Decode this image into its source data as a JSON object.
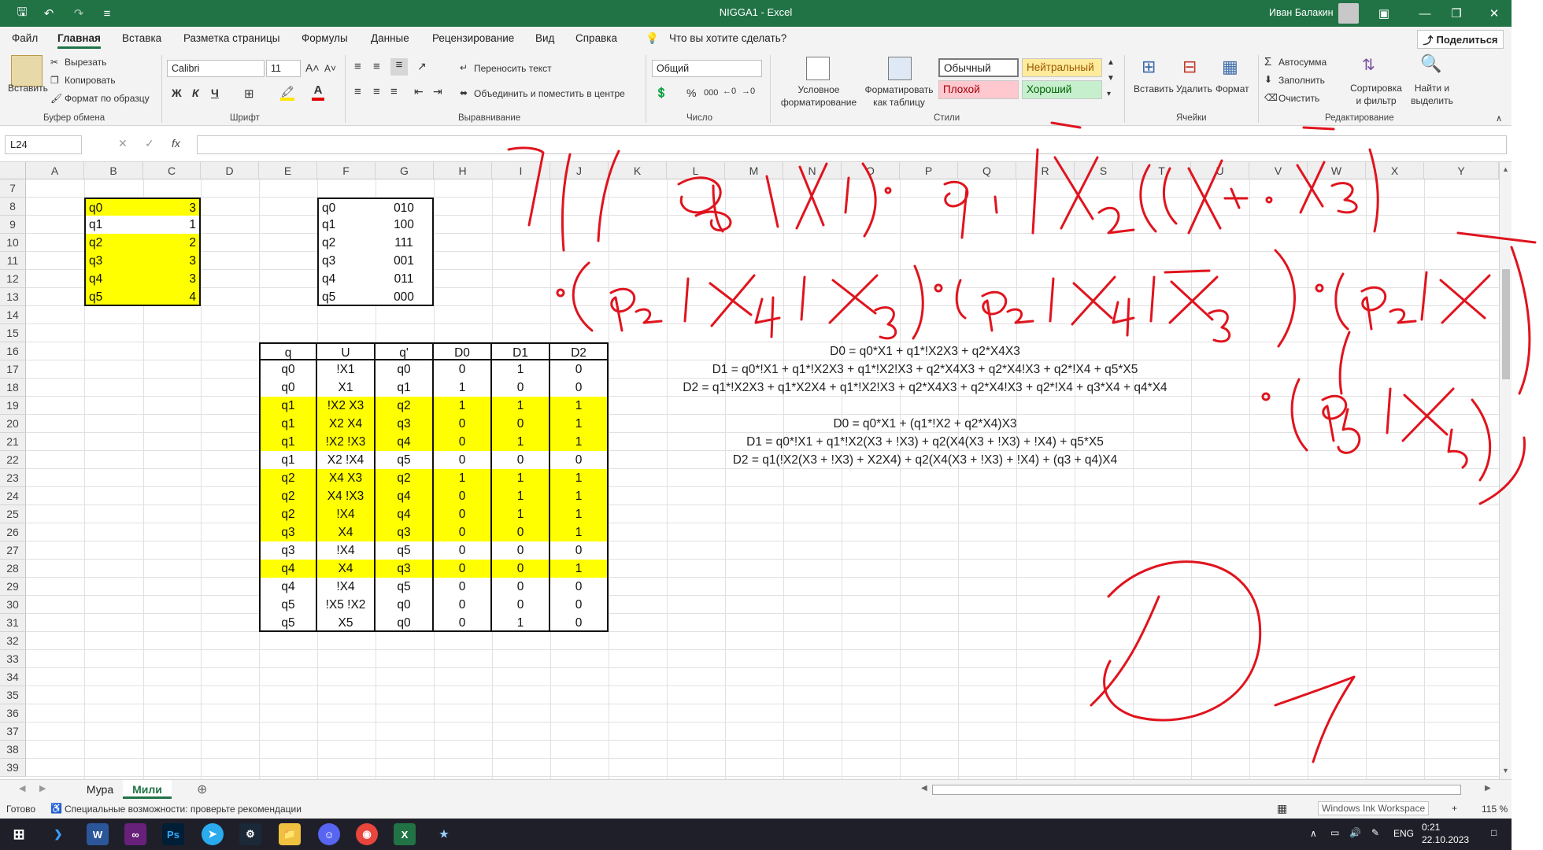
{
  "window": {
    "title": "NIGGA1 - Excel",
    "user": "Иван Балакин"
  },
  "menu": {
    "tabs": [
      "Файл",
      "Главная",
      "Вставка",
      "Разметка страницы",
      "Формулы",
      "Данные",
      "Рецензирование",
      "Вид",
      "Справка"
    ],
    "search": "Что вы хотите сделать?",
    "share": "Поделиться"
  },
  "ribbon": {
    "clipboard": {
      "paste": "Вставить",
      "cut": "Вырезать",
      "copy": "Копировать",
      "format_painter": "Формат по образцу",
      "label": "Буфер обмена"
    },
    "font": {
      "name": "Calibri",
      "size": "11",
      "bold": "Ж",
      "italic": "К",
      "underline": "Ч",
      "label": "Шрифт"
    },
    "alignment": {
      "wrap": "Переносить текст",
      "merge": "Объединить и поместить в центре",
      "label": "Выравнивание"
    },
    "number": {
      "format": "Общий",
      "label": "Число"
    },
    "styles": {
      "conditional": "Условное форматирование",
      "table": "Форматировать как таблицу",
      "normal": "Обычный",
      "neutral": "Нейтральный",
      "bad": "Плохой",
      "good": "Хороший",
      "label": "Стили"
    },
    "cells": {
      "insert": "Вставить",
      "delete": "Удалить",
      "format": "Формат",
      "label": "Ячейки"
    },
    "editing": {
      "autosum": "Автосумма",
      "fill": "Заполнить",
      "clear": "Очистить",
      "sort": "Сортировка и фильтр",
      "find": "Найти и выделить",
      "label": "Редактирование"
    }
  },
  "formula_bar": {
    "name_box": "L24",
    "fx": "fx"
  },
  "columns": [
    "A",
    "B",
    "C",
    "D",
    "E",
    "F",
    "G",
    "H",
    "I",
    "J",
    "K",
    "L",
    "M",
    "N",
    "O",
    "P",
    "Q",
    "R",
    "S",
    "T",
    "U",
    "V",
    "W",
    "X",
    "Y"
  ],
  "rows": [
    "7",
    "8",
    "9",
    "10",
    "11",
    "12",
    "13",
    "14",
    "15",
    "16",
    "17",
    "18",
    "19",
    "20",
    "21",
    "22",
    "23",
    "24",
    "25",
    "26",
    "27",
    "28",
    "29",
    "30",
    "31",
    "32",
    "33",
    "34",
    "35",
    "36",
    "37",
    "38",
    "39"
  ],
  "table_left": [
    [
      "q0",
      "3"
    ],
    [
      "q1",
      "1"
    ],
    [
      "q2",
      "2"
    ],
    [
      "q3",
      "3"
    ],
    [
      "q4",
      "3"
    ],
    [
      "q5",
      "4"
    ]
  ],
  "table_codes": [
    [
      "q0",
      "010"
    ],
    [
      "q1",
      "100"
    ],
    [
      "q2",
      "111"
    ],
    [
      "q3",
      "001"
    ],
    [
      "q4",
      "011"
    ],
    [
      "q5",
      "000"
    ]
  ],
  "transitions": {
    "headers": [
      "q",
      "U",
      "q'",
      "D0",
      "D1",
      "D2"
    ],
    "rows": [
      [
        "q0",
        "!X1",
        "q0",
        "0",
        "1",
        "0"
      ],
      [
        "q0",
        "X1",
        "q1",
        "1",
        "0",
        "0"
      ],
      [
        "q1",
        "!X2 X3",
        "q2",
        "1",
        "1",
        "1"
      ],
      [
        "q1",
        "X2 X4",
        "q3",
        "0",
        "0",
        "1"
      ],
      [
        "q1",
        "!X2 !X3",
        "q4",
        "0",
        "1",
        "1"
      ],
      [
        "q1",
        "X2 !X4",
        "q5",
        "0",
        "0",
        "0"
      ],
      [
        "q2",
        "X4 X3",
        "q2",
        "1",
        "1",
        "1"
      ],
      [
        "q2",
        "X4 !X3",
        "q4",
        "0",
        "1",
        "1"
      ],
      [
        "q2",
        "!X4",
        "q4",
        "0",
        "1",
        "1"
      ],
      [
        "q3",
        "X4",
        "q3",
        "0",
        "0",
        "1"
      ],
      [
        "q3",
        "!X4",
        "q5",
        "0",
        "0",
        "0"
      ],
      [
        "q4",
        "X4",
        "q3",
        "0",
        "0",
        "1"
      ],
      [
        "q4",
        "!X4",
        "q5",
        "0",
        "0",
        "0"
      ],
      [
        "q5",
        "!X5 !X2",
        "q0",
        "0",
        "0",
        "0"
      ],
      [
        "q5",
        "X5",
        "q0",
        "0",
        "1",
        "0"
      ]
    ]
  },
  "formulas": [
    "D0 = q0*X1 + q1*!X2X3 + q2*X4X3",
    "D1 = q0*!X1 + q1*!X2X3 + q1*!X2!X3 + q2*X4X3 +  q2*X4!X3 + q2*!X4 + q5*X5",
    "D2 = q1*!X2X3 + q1*X2X4 + q1*!X2!X3 + q2*X4X3 + q2*X4!X3 + q2*!X4 + q3*X4 + q4*X4",
    "D0 = q0*X1 + (q1*!X2 + q2*X4)X3",
    "D1 = q0*!X1 + q1*!X2(X3 + !X3) + q2(X4(X3 + !X3) + !X4) + q5*X5",
    "D2 = q1(!X2(X3 + !X3) + X2X4) + q2(X4(X3 + !X3) + !X4) + (q3 + q4)X4"
  ],
  "sheets": [
    "Мура",
    "Мили"
  ],
  "status": {
    "ready": "Готово",
    "accessibility": "Специальные возможности: проверьте рекомендации",
    "ink": "Windows Ink Workspace",
    "zoom": "115 %"
  },
  "taskbar": {
    "lang": "ENG",
    "time": "0:21",
    "date": "22.10.2023"
  },
  "ink_color": "#e0141e"
}
